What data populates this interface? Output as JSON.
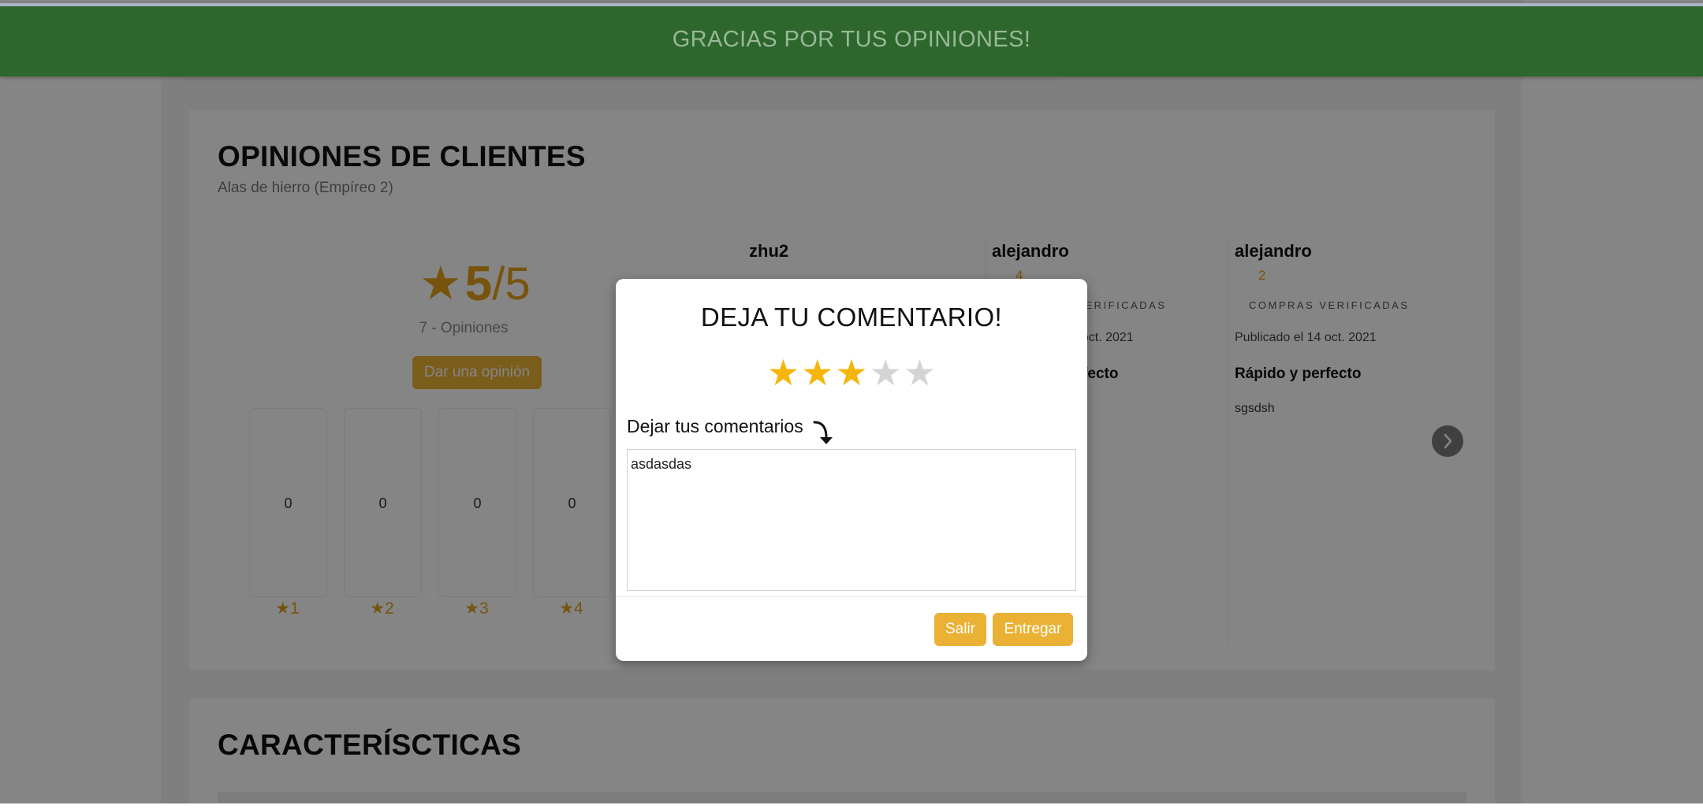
{
  "banner": {
    "text": "GRACIAS POR TUS OPINIONES!"
  },
  "reviews": {
    "title": "OPINIONES DE CLIENTES",
    "subtitle": "Alas de hierro (Empíreo 2)",
    "summary": {
      "star_icon": "star-icon",
      "score": "5",
      "out_of": "/5",
      "count_text": "7 - Opiniones",
      "give_review_label": "Dar una opinión"
    },
    "histogram": [
      {
        "count": "0",
        "label": "★1"
      },
      {
        "count": "0",
        "label": "★2"
      },
      {
        "count": "0",
        "label": "★3"
      },
      {
        "count": "0",
        "label": "★4"
      }
    ],
    "cards": [
      {
        "user": "zhu2",
        "rating": "",
        "verified": "",
        "date": "",
        "heading": "",
        "body": ""
      },
      {
        "user": "alejandro",
        "rating": "4",
        "verified": "COMPRAS VERIFICADAS",
        "date": "Publicado el 14 oct. 2021",
        "heading": "Rápido y perfecto",
        "body": ""
      },
      {
        "user": "alejandro",
        "rating": "2",
        "verified": "COMPRAS VERIFICADAS",
        "date": "Publicado el 14 oct. 2021",
        "heading": "Rápido y perfecto",
        "body": "sgsdsh"
      }
    ]
  },
  "features": {
    "title": "CARACTERÍSCTICAS"
  },
  "modal": {
    "title": "DEJA TU COMENTARIO!",
    "rating": 3,
    "max_rating": 5,
    "star_filled_color": "#f5b50a",
    "star_empty_color": "#d4d4d4",
    "comment_label": "Dejar tus comentarios",
    "comment_value": "asdasdas",
    "exit_label": "Salir",
    "submit_label": "Entregar"
  },
  "colors": {
    "banner": "#2d672d",
    "accent": "#eab134",
    "star": "#e4a11b"
  }
}
